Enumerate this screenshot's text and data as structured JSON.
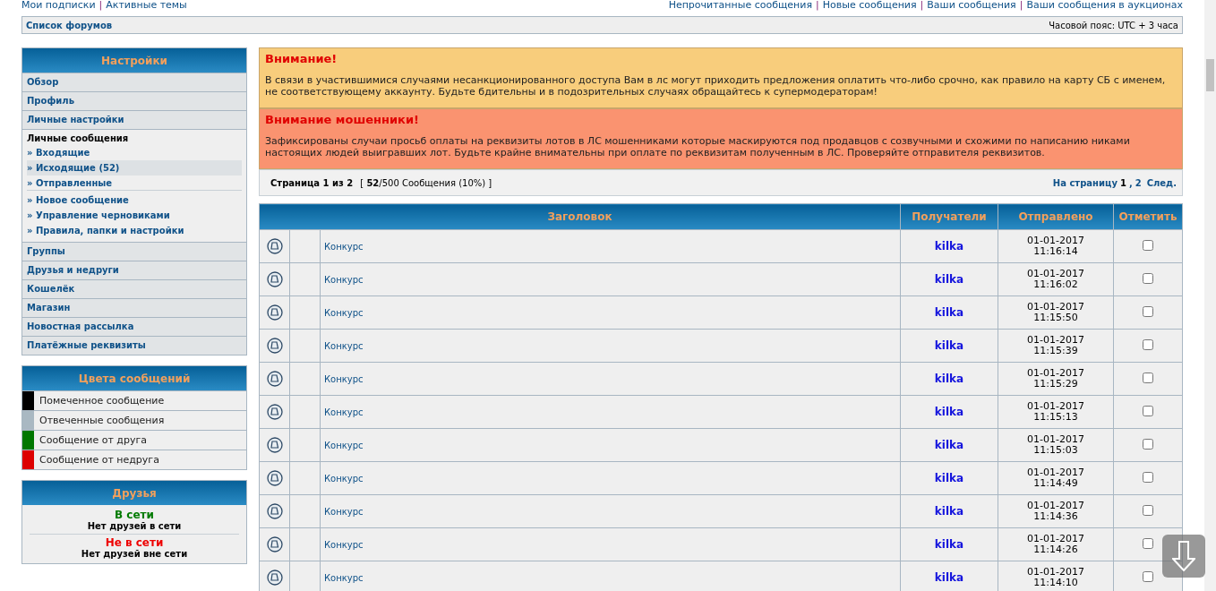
{
  "top_links_left": [
    "Мои подписки",
    "|",
    "Активные темы"
  ],
  "top_links_right": [
    "Непрочитанные сообщения",
    "|",
    "Новые сообщения",
    "|",
    "Ваши сообщения",
    "|",
    "Ваши сообщения в аукционах"
  ],
  "navbar": {
    "breadcrumb": "Список форумов",
    "timezone": "Часовой пояс: UTC + 3 часа"
  },
  "settings_menu": {
    "title": "Настройки",
    "items": [
      {
        "kind": "link",
        "label": "Обзор"
      },
      {
        "kind": "link",
        "label": "Профиль"
      },
      {
        "kind": "link",
        "label": "Личные настройки"
      },
      {
        "kind": "group",
        "label": "Личные сообщения",
        "children": [
          {
            "label": "» Входящие",
            "selected": false,
            "divider_after": false
          },
          {
            "label": "» Исходящие (52)",
            "selected": true,
            "divider_after": false
          },
          {
            "label": "» Отправленные",
            "selected": false,
            "divider_after": true
          },
          {
            "label": "» Новое сообщение",
            "selected": false,
            "divider_after": false
          },
          {
            "label": "» Управление черновиками",
            "selected": false,
            "divider_after": false
          },
          {
            "label": "» Правила, папки и настройки",
            "selected": false,
            "divider_after": false
          }
        ]
      },
      {
        "kind": "link",
        "label": "Группы"
      },
      {
        "kind": "link",
        "label": "Друзья и недруги"
      },
      {
        "kind": "link",
        "label": "Кошелёк"
      },
      {
        "kind": "link",
        "label": "Магазин"
      },
      {
        "kind": "link",
        "label": "Новостная рассылка"
      },
      {
        "kind": "link",
        "label": "Платёжные реквизиты"
      }
    ]
  },
  "message_colors": {
    "title": "Цвета сообщений",
    "items": [
      {
        "label": "Помеченное сообщение",
        "color": "#000000"
      },
      {
        "label": "Отвеченные сообщения",
        "color": "#a9b8c2"
      },
      {
        "label": "Сообщение от друга",
        "color": "#007700"
      },
      {
        "label": "Сообщение от недруга",
        "color": "#dd0000"
      }
    ]
  },
  "friends": {
    "title": "Друзья",
    "online_label": "В сети",
    "online_text": "Нет друзей в сети",
    "offline_label": "Не в сети",
    "offline_text": "Нет друзей вне сети"
  },
  "notices": [
    {
      "kind": "warning",
      "title": "Внимание!",
      "text": "В связи в участившимися случаями несанкционированного доступа Вам в лс могут приходить предложения оплатить что-либо срочно, как правило на карту СБ с именем, не соответствующему аккаунту. Будьте бдительны и в подозрительных случаях обращайтесь к супермодераторам!"
    },
    {
      "kind": "danger",
      "title": "Внимание мошенники!",
      "text": "Зафиксированы случаи просьб оплаты на реквизиты лотов в ЛС мошенниками которые маскируются под продавцов с созвучными и схожими по написанию никами настоящих людей выигравших лот. Будьте крайне внимательны при оплате по реквизитам полученным в ЛС. Проверяйте отправителя реквизитов."
    }
  ],
  "pagination": {
    "page_info": "Страница 1 из 2",
    "count": "[ **52**/500 Сообщения (10%) ]",
    "goto_label": "На страницу",
    "pages": [
      {
        "label": "1",
        "selected": true
      },
      {
        "label": "2",
        "selected": false
      }
    ],
    "page_separator": ",",
    "next": "След."
  },
  "table": {
    "columns": [
      "Заголовок",
      "Получатели",
      "Отправлено",
      "Отметить"
    ],
    "rows": [
      {
        "title": "Конкурс",
        "recipient": "kilka",
        "date": "01-01-2017",
        "time": "11:16:14",
        "checked": false
      },
      {
        "title": "Конкурс",
        "recipient": "kilka",
        "date": "01-01-2017",
        "time": "11:16:02",
        "checked": false
      },
      {
        "title": "Конкурс",
        "recipient": "kilka",
        "date": "01-01-2017",
        "time": "11:15:50",
        "checked": false
      },
      {
        "title": "Конкурс",
        "recipient": "kilka",
        "date": "01-01-2017",
        "time": "11:15:39",
        "checked": false
      },
      {
        "title": "Конкурс",
        "recipient": "kilka",
        "date": "01-01-2017",
        "time": "11:15:29",
        "checked": false
      },
      {
        "title": "Конкурс",
        "recipient": "kilka",
        "date": "01-01-2017",
        "time": "11:15:13",
        "checked": false
      },
      {
        "title": "Конкурс",
        "recipient": "kilka",
        "date": "01-01-2017",
        "time": "11:15:03",
        "checked": false
      },
      {
        "title": "Конкурс",
        "recipient": "kilka",
        "date": "01-01-2017",
        "time": "11:14:49",
        "checked": false
      },
      {
        "title": "Конкурс",
        "recipient": "kilka",
        "date": "01-01-2017",
        "time": "11:14:36",
        "checked": false
      },
      {
        "title": "Конкурс",
        "recipient": "kilka",
        "date": "01-01-2017",
        "time": "11:14:26",
        "checked": false
      },
      {
        "title": "Конкурс",
        "recipient": "kilka",
        "date": "01-01-2017",
        "time": "11:14:10",
        "checked": false
      }
    ]
  }
}
